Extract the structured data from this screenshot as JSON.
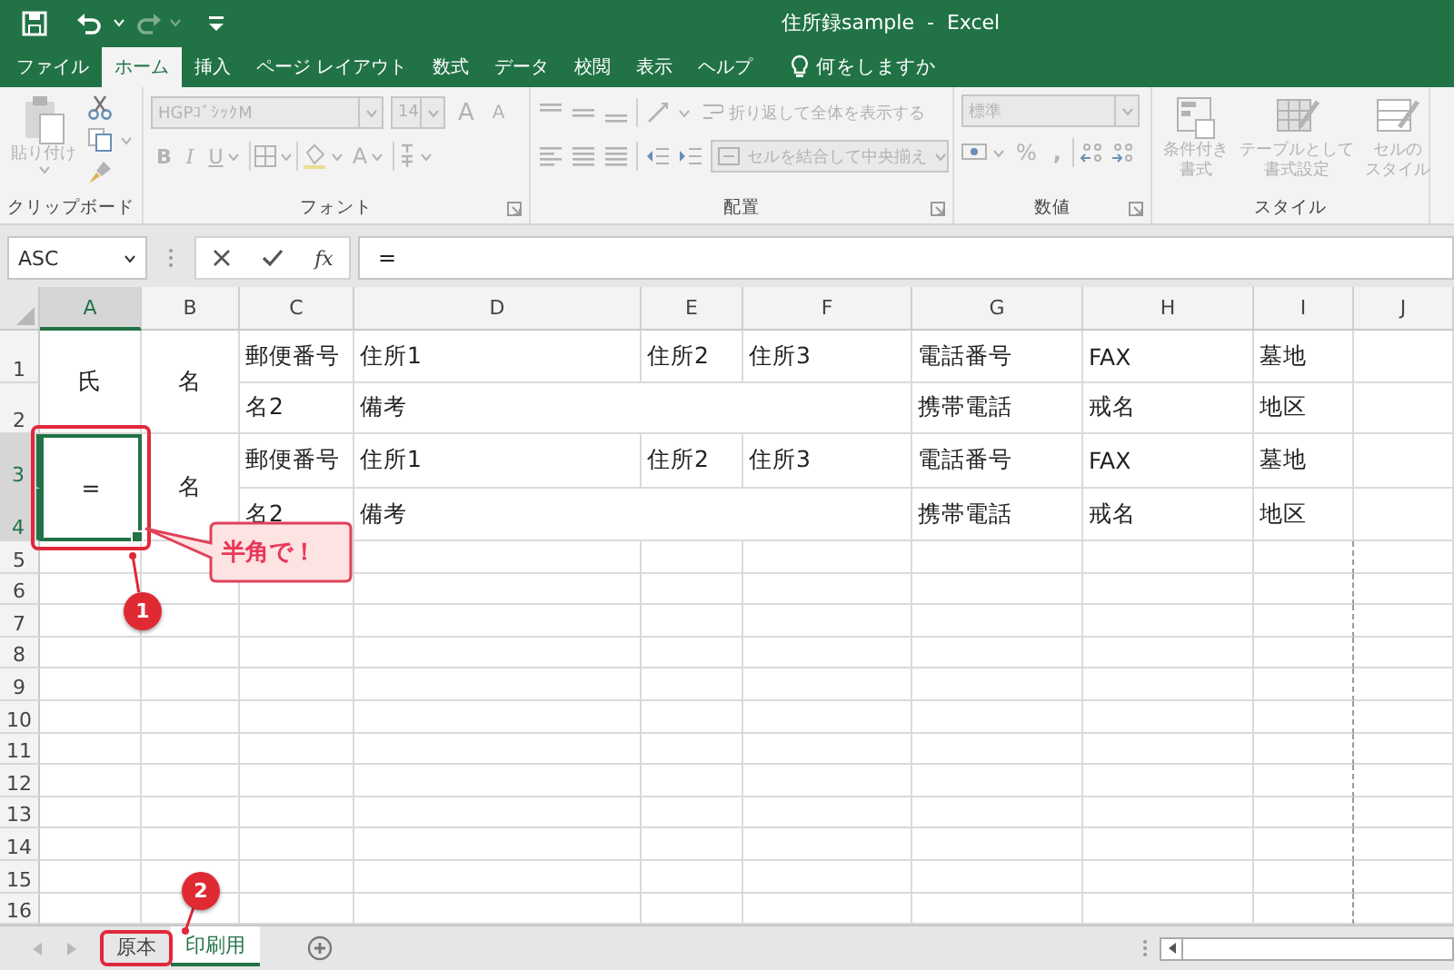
{
  "window": {
    "title": "住所録sample  -  Excel"
  },
  "ribbon_tabs": [
    {
      "label": "ファイル",
      "selected": false
    },
    {
      "label": "ホーム",
      "selected": true
    },
    {
      "label": "挿入",
      "selected": false
    },
    {
      "label": "ページ レイアウト",
      "selected": false
    },
    {
      "label": "数式",
      "selected": false
    },
    {
      "label": "データ",
      "selected": false
    },
    {
      "label": "校閲",
      "selected": false
    },
    {
      "label": "表示",
      "selected": false
    },
    {
      "label": "ヘルプ",
      "selected": false
    }
  ],
  "tell_me": {
    "placeholder": "何をしますか"
  },
  "ribbon": {
    "disabled": true,
    "clipboard": {
      "label": "クリップボード",
      "paste": "貼り付け"
    },
    "font": {
      "label": "フォント",
      "font_name": "HGPｺﾞｼｯｸM",
      "font_size": "14",
      "grow_font": "A",
      "shrink_font": "A",
      "bold": "B",
      "italic": "I",
      "underline": "U",
      "font_color": "A"
    },
    "alignment": {
      "label": "配置",
      "wrap_text": "折り返して全体を表示する",
      "merge": "セルを結合して中央揃え"
    },
    "number": {
      "label": "数値",
      "format": "標準",
      "percent": "%",
      "comma": ","
    },
    "styles": {
      "label": "スタイル",
      "conditional": [
        "条件付き",
        "書式"
      ],
      "table": [
        "テーブルとして",
        "書式設定"
      ],
      "cell_styles": [
        "セルの",
        "スタイル"
      ]
    }
  },
  "formula_bar": {
    "name_box": "ASC",
    "function_label": "fx",
    "value": "="
  },
  "columns": [
    {
      "label": "A",
      "selected": true
    },
    {
      "label": "B",
      "selected": false
    },
    {
      "label": "C",
      "selected": false
    },
    {
      "label": "D",
      "selected": false
    },
    {
      "label": "E",
      "selected": false
    },
    {
      "label": "F",
      "selected": false
    },
    {
      "label": "G",
      "selected": false
    },
    {
      "label": "H",
      "selected": false
    },
    {
      "label": "I",
      "selected": false
    },
    {
      "label": "J",
      "selected": false
    }
  ],
  "rows": [
    {
      "label": "1",
      "selected": false
    },
    {
      "label": "2",
      "selected": false
    },
    {
      "label": "3",
      "selected": true
    },
    {
      "label": "4",
      "selected": true
    },
    {
      "label": "5",
      "selected": false
    },
    {
      "label": "6",
      "selected": false
    },
    {
      "label": "7",
      "selected": false
    },
    {
      "label": "8",
      "selected": false
    },
    {
      "label": "9",
      "selected": false
    },
    {
      "label": "10",
      "selected": false
    },
    {
      "label": "11",
      "selected": false
    },
    {
      "label": "12",
      "selected": false
    },
    {
      "label": "13",
      "selected": false
    },
    {
      "label": "14",
      "selected": false
    },
    {
      "label": "15",
      "selected": false
    },
    {
      "label": "16",
      "selected": false
    }
  ],
  "table_rows": [
    {
      "cells": [
        {
          "text": "氏",
          "selected": false
        },
        {
          "text": "名",
          "selected": false
        },
        {
          "text": "郵便番号",
          "selected": false
        },
        {
          "text": "住所1",
          "selected": false
        },
        {
          "text": "住所2",
          "selected": false
        },
        {
          "text": "住所3",
          "selected": false
        },
        {
          "text": "電話番号",
          "selected": false
        },
        {
          "text": "FAX",
          "selected": false
        },
        {
          "text": "墓地",
          "selected": false
        }
      ]
    },
    {
      "cells": [
        {
          "text": "名2",
          "selected": false
        },
        {
          "text": "備考",
          "selected": false
        },
        {
          "text": "携帯電話",
          "selected": false
        },
        {
          "text": "戒名",
          "selected": false
        },
        {
          "text": "地区",
          "selected": false
        }
      ]
    },
    {
      "cells": [
        {
          "text": "=",
          "selected": true
        },
        {
          "text": "名",
          "selected": false
        },
        {
          "text": "郵便番号",
          "selected": false
        },
        {
          "text": "住所1",
          "selected": false
        },
        {
          "text": "住所2",
          "selected": false
        },
        {
          "text": "住所3",
          "selected": false
        },
        {
          "text": "電話番号",
          "selected": false
        },
        {
          "text": "FAX",
          "selected": false
        },
        {
          "text": "墓地",
          "selected": false
        }
      ]
    },
    {
      "cells": [
        {
          "text": "名2",
          "selected": false
        },
        {
          "text": "備考",
          "selected": false
        },
        {
          "text": "携帯電話",
          "selected": false
        },
        {
          "text": "戒名",
          "selected": false
        },
        {
          "text": "地区",
          "selected": false
        }
      ]
    }
  ],
  "sheet_tabs": [
    {
      "label": "原本",
      "selected": false
    },
    {
      "label": "印刷用",
      "selected": true
    }
  ],
  "annotations": [
    {
      "kind": "cell_highlight"
    },
    {
      "kind": "callout",
      "text": "半角で！"
    },
    {
      "kind": "badge",
      "text": "1"
    },
    {
      "kind": "tab_highlight"
    },
    {
      "kind": "badge",
      "text": "2"
    }
  ]
}
